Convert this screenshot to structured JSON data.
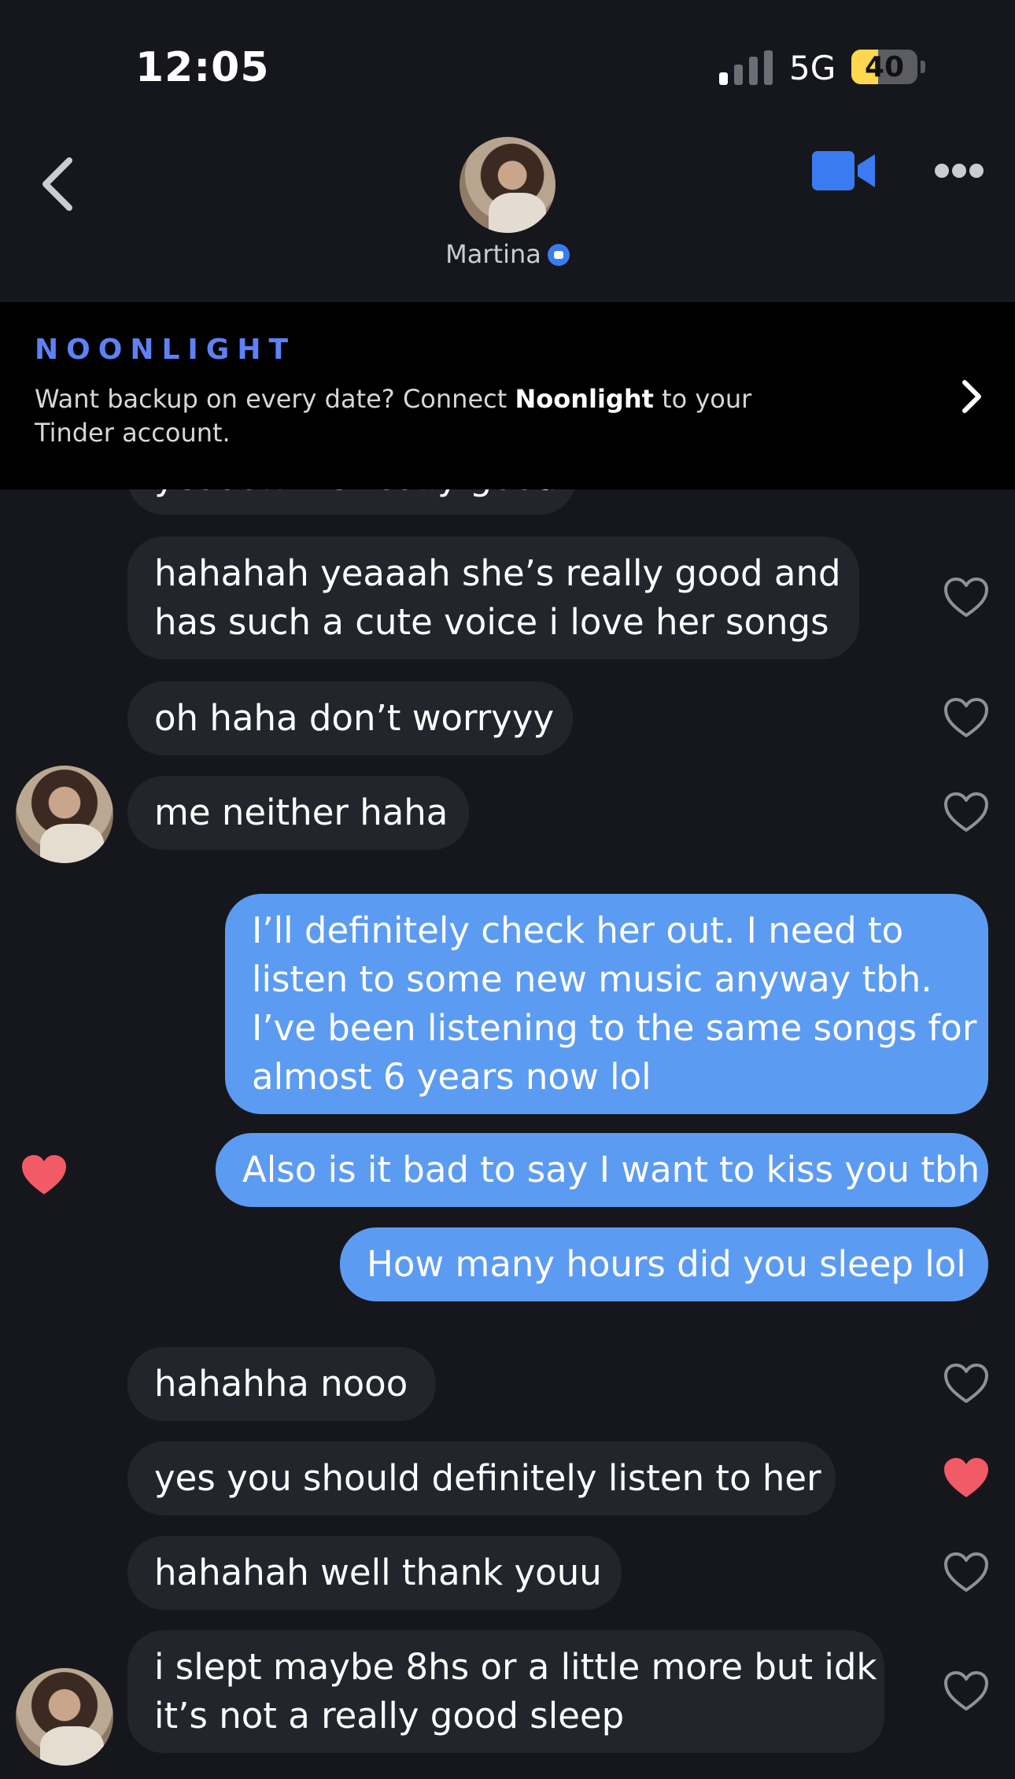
{
  "status": {
    "time": "12:05",
    "network": "5G",
    "battery_level": "40",
    "battery_fraction": 0.4,
    "signal_bars_on": 1,
    "signal_bars_total": 4
  },
  "header": {
    "contact_name": "Martina",
    "back_icon": "chevron-left-icon",
    "video_icon": "video-camera-icon",
    "more_icon": "ellipsis-icon",
    "verified_icon": "verified-badge-icon"
  },
  "banner": {
    "brand": "NOONLIGHT",
    "text_before": "Want backup on every date? Connect ",
    "text_bold": "Noonlight",
    "text_after": " to your Tinder account."
  },
  "colors": {
    "accent": "#5c9bf2",
    "brand_blue": "#3a7bf2",
    "heart_liked": "#f25a66",
    "background": "#16171c",
    "bubble_received": "#23252c"
  },
  "messages": [
    {
      "side": "received",
      "lines": [
        "yeaaah it’s really good"
      ],
      "liked": false
    },
    {
      "side": "received",
      "lines": [
        "hahahah yeaaah she’s really good and",
        "has such a cute voice i love her songs"
      ],
      "liked": false
    },
    {
      "side": "received",
      "lines": [
        "oh haha don’t worryyy"
      ],
      "liked": false
    },
    {
      "side": "received",
      "lines": [
        "me neither haha"
      ],
      "liked": false,
      "avatar": true
    },
    {
      "side": "sent",
      "lines": [
        "I’ll definitely check her out. I need to",
        "listen to some new music anyway tbh.",
        "I’ve been listening to the same songs for",
        "almost 6 years now lol"
      ]
    },
    {
      "side": "sent",
      "lines": [
        "Also is it bad to say I want to kiss you tbh"
      ],
      "liked_by_them": true
    },
    {
      "side": "sent",
      "lines": [
        "How many hours did you sleep lol"
      ]
    },
    {
      "side": "received",
      "lines": [
        "hahahha nooo"
      ],
      "liked": false
    },
    {
      "side": "received",
      "lines": [
        "yes you should definitely listen to her"
      ],
      "liked": true
    },
    {
      "side": "received",
      "lines": [
        "hahahah well thank youu"
      ],
      "liked": false
    },
    {
      "side": "received",
      "lines": [
        "i slept maybe 8hs or a little more but idk",
        "it’s not a really good sleep"
      ],
      "liked": false,
      "avatar": true
    }
  ]
}
